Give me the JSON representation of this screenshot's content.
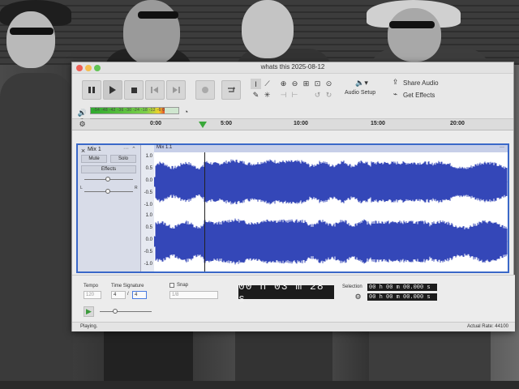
{
  "window": {
    "title": "whats this 2025-08-12",
    "traffic_lights": [
      "#ee5e55",
      "#f4bd4f",
      "#61c454"
    ]
  },
  "toolbar": {
    "transport": {
      "pause_icon": "pause-icon",
      "play_icon": "play-icon",
      "stop_icon": "stop-icon",
      "skip_start_icon": "skip-start-icon",
      "skip_end_icon": "skip-end-icon",
      "record_icon": "record-icon",
      "loop_icon": "loop-icon"
    },
    "audio_setup_label": "Audio Setup",
    "share_audio_label": "Share Audio",
    "get_effects_label": "Get Effects",
    "record_meter_scale": "-54 -48 -42 -36 -30 -24 -18 -12 -6 0",
    "playback_meter_scale": "-54 -48 -42 -36 -30 -24 -18 -12 -6 0",
    "playback_meter_fill": 0.84,
    "record_meter_fill": 0.0
  },
  "ruler": {
    "labels": [
      "0:00",
      "5:00",
      "10:00",
      "15:00",
      "20:00"
    ],
    "playhead_icon": "playhead-marker-icon"
  },
  "track": {
    "name": "Mix 1",
    "mute_label": "Mute",
    "solo_label": "Solo",
    "effects_label": "Effects",
    "pan_left_label": "L",
    "pan_right_label": "R",
    "clip_name": "Mix 1.1",
    "amplitude_labels": [
      "1.0",
      "0.5",
      "0.0",
      "-0.5",
      "-1.0"
    ],
    "wave_color": "#3447b8"
  },
  "bottom": {
    "tempo_label": "Tempo",
    "tempo_value": "120",
    "time_signature_label": "Time Signature",
    "time_sig_top": "4",
    "time_sig_bottom": "4",
    "snap_label": "Snap",
    "snap_value": "1/8",
    "timer": "00 h 03 m 28 s",
    "selection_label": "Selection",
    "selection_start": "00 h 00 m 00.000 s",
    "selection_end": "00 h 00 m 00.000 s"
  },
  "status": {
    "left": "Playing.",
    "right": "Actual Rate: 44100"
  }
}
